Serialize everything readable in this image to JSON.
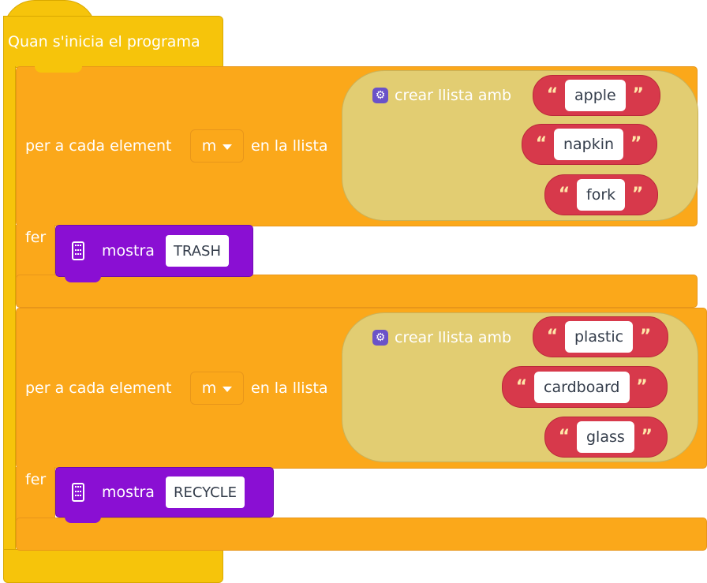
{
  "event": {
    "label": "Quan s'inicia el programa"
  },
  "colors": {
    "event": "#f6c40b",
    "loop": "#fba81a",
    "list": "#e2cd72",
    "string": "#d7394b",
    "mostra": "#8a0fd3",
    "gear": "#6a52c8"
  },
  "loops": [
    {
      "prefix": "per a cada element",
      "variable": "m",
      "middle": "en la llista",
      "list_header": "crear llista amb",
      "items": [
        "apple",
        "napkin",
        "fork"
      ],
      "do_label": "fer",
      "action_label": "mostra",
      "action_value": "TRASH"
    },
    {
      "prefix": "per a cada element",
      "variable": "m",
      "middle": "en la llista",
      "list_header": "crear llista amb",
      "items": [
        "plastic",
        "cardboard",
        "glass"
      ],
      "do_label": "fer",
      "action_label": "mostra",
      "action_value": "RECYCLE"
    }
  ],
  "quote_open": "“",
  "quote_close": "”",
  "icons": {
    "gear": "gear-icon",
    "microbit": "microbit-icon",
    "dropdown": "chevron-down-icon"
  }
}
